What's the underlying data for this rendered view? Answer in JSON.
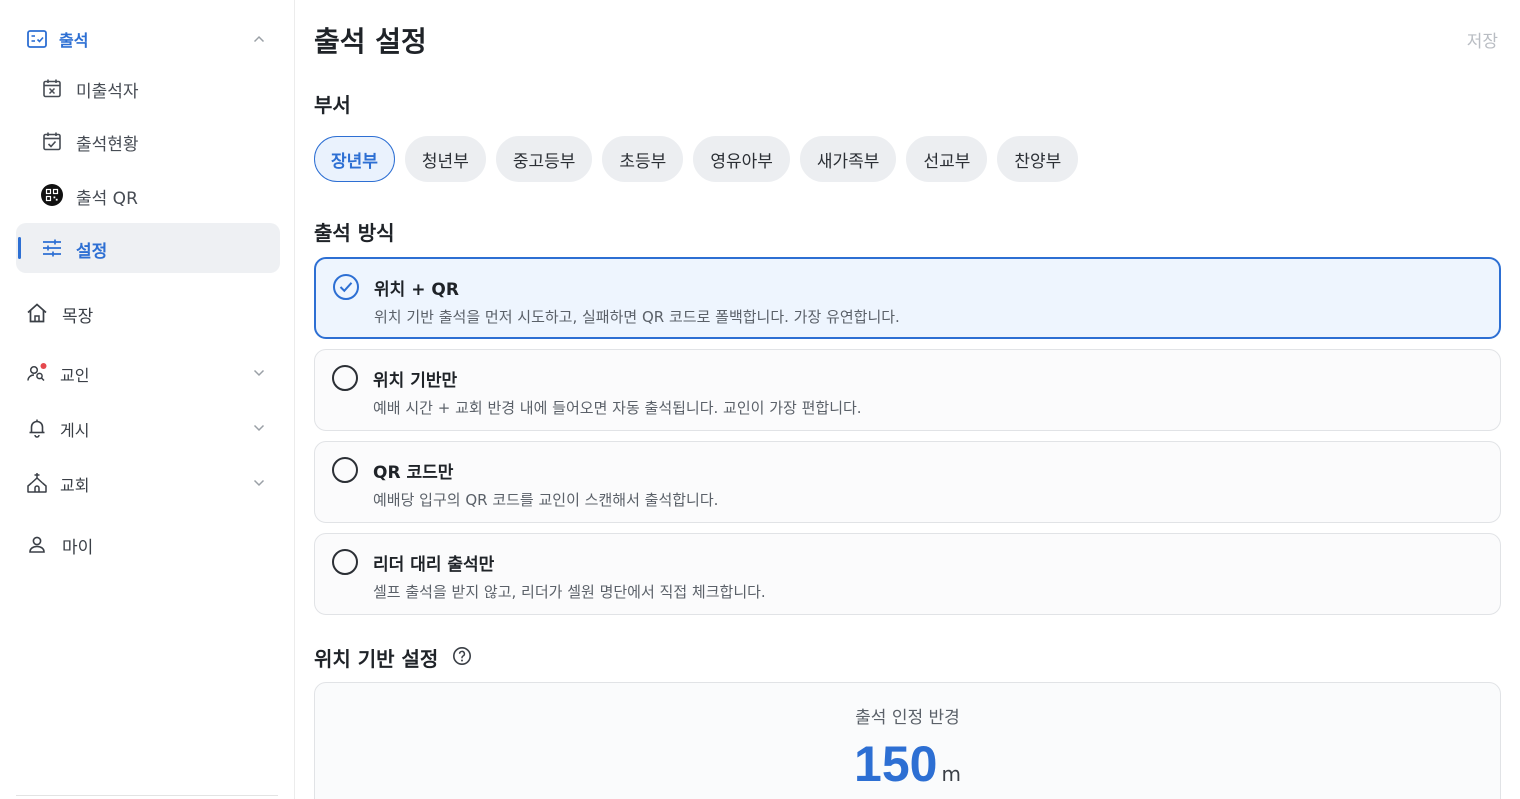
{
  "sidebar": {
    "attendance_group": {
      "label": "출석"
    },
    "sub_items": [
      {
        "label": "미출석자",
        "icon": "calendar-x-icon"
      },
      {
        "label": "출석현황",
        "icon": "calendar-check-icon"
      },
      {
        "label": "출석 QR",
        "icon": "qr-code-icon"
      },
      {
        "label": "설정",
        "icon": "sliders-icon",
        "selected": true
      }
    ],
    "items": [
      {
        "label": "목장",
        "icon": "home-icon"
      },
      {
        "label": "교인",
        "icon": "users-icon",
        "has_badge": true
      },
      {
        "label": "게시",
        "icon": "bell-icon"
      },
      {
        "label": "교회",
        "icon": "church-icon"
      },
      {
        "label": "마이",
        "icon": "user-icon"
      }
    ]
  },
  "header": {
    "title": "출석 설정",
    "save_label": "저장"
  },
  "department": {
    "title": "부서",
    "chips": [
      "장년부",
      "청년부",
      "중고등부",
      "초등부",
      "영유아부",
      "새가족부",
      "선교부",
      "찬양부"
    ],
    "selected": "장년부"
  },
  "method": {
    "title": "출석 방식",
    "options": [
      {
        "title": "위치 + QR",
        "desc": "위치 기반 출석을 먼저 시도하고, 실패하면 QR 코드로 폴백합니다. 가장 유연합니다.",
        "selected": true
      },
      {
        "title": "위치 기반만",
        "desc": "예배 시간 + 교회 반경 내에 들어오면 자동 출석됩니다. 교인이 가장 편합니다.",
        "selected": false
      },
      {
        "title": "QR 코드만",
        "desc": "예배당 입구의 QR 코드를 교인이 스캔해서 출석합니다.",
        "selected": false
      },
      {
        "title": "리더 대리 출석만",
        "desc": "셀프 출석을 받지 않고, 리더가 셀원 명단에서 직접 체크합니다.",
        "selected": false
      }
    ]
  },
  "location": {
    "title": "위치 기반 설정",
    "radius_label": "출석 인정 반경",
    "radius_value": "150",
    "radius_unit": "m"
  },
  "colors": {
    "accent": "#2d6fd3",
    "badge": "#e5484d"
  }
}
